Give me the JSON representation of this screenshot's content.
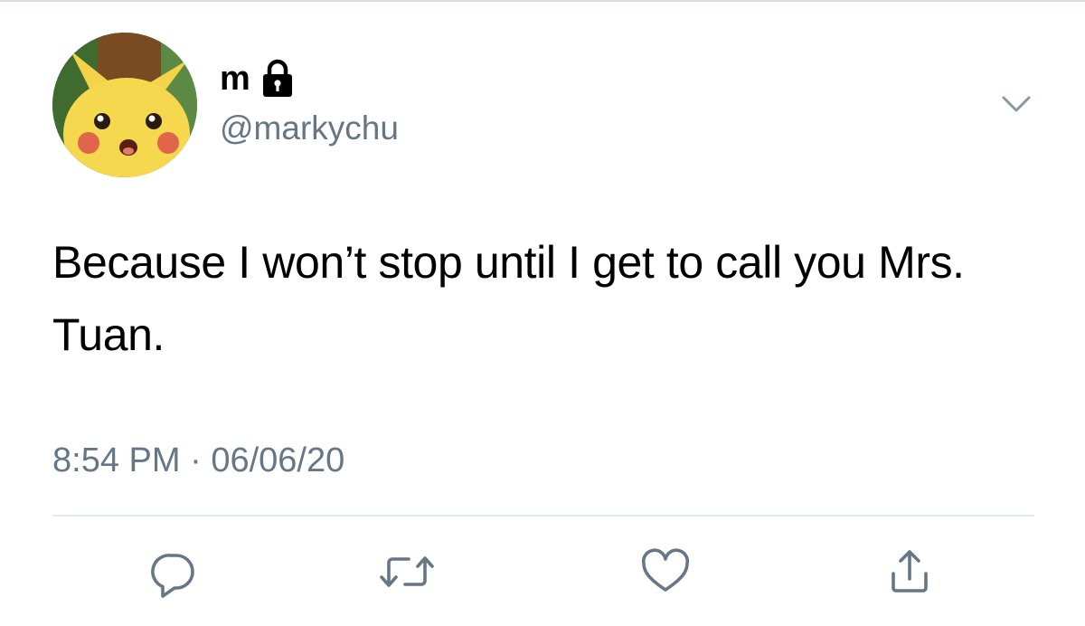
{
  "tweet": {
    "author": {
      "display_name": "m",
      "handle": "@markychu",
      "protected_icon": "lock-icon",
      "avatar": "avatar-image"
    },
    "text": "Because I won’t stop until I get to call you Mrs. Tuan.",
    "time": "8:54 PM",
    "separator": " · ",
    "date": "06/06/20",
    "menu_icon": "chevron-down-icon"
  },
  "actions": [
    {
      "name": "reply",
      "icon": "reply-icon"
    },
    {
      "name": "retweet",
      "icon": "retweet-icon"
    },
    {
      "name": "like",
      "icon": "heart-icon"
    },
    {
      "name": "share",
      "icon": "share-icon"
    }
  ],
  "colors": {
    "primary_text": "#000000",
    "secondary_text": "#657786",
    "icon_gray": "#657786",
    "divider": "#e1e8ed"
  }
}
